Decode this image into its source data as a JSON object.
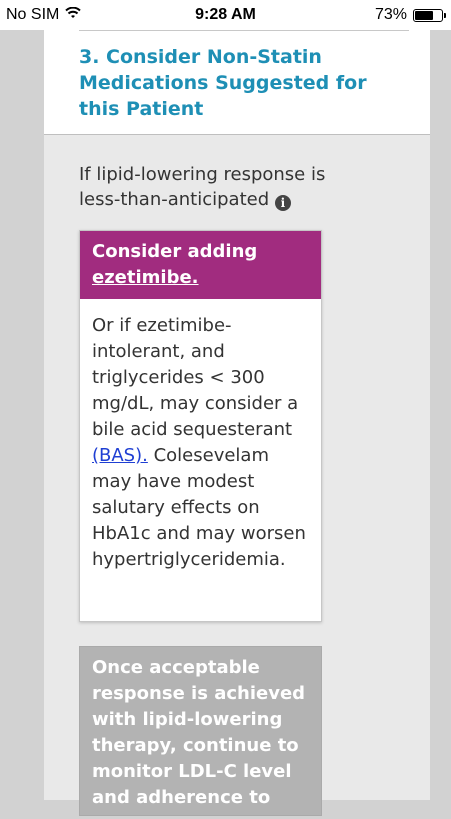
{
  "status_bar": {
    "carrier": "No SIM",
    "time": "9:28 AM",
    "battery_percent": "73%",
    "battery_level": 0.73,
    "wifi_icon": "wifi-icon",
    "battery_icon": "battery-icon"
  },
  "section": {
    "title": "3. Consider Non-Statin Medications Suggested for this Patient"
  },
  "intro": {
    "text": "If lipid-lowering response is less-than-anticipated",
    "info_icon": "info-icon"
  },
  "card": {
    "head_prefix": "Consider adding",
    "head_link": "ezetimibe.",
    "body_before": "Or if ezetimibe-intolerant, and triglycerides < 300 mg/dL, may consider a bile acid sequesterant",
    "body_link": "(BAS).",
    "body_after": "Colesevelam may have modest salutary effects on HbA1c and may worsen hypertriglyceridemia."
  },
  "next_card": {
    "text": "Once acceptable response is achieved with lipid-lowering therapy, continue to monitor LDL-C level and adherence to"
  },
  "colors": {
    "title_blue": "#1e8fb5",
    "card_header_magenta": "#a12c7f",
    "link_blue": "#1f3fd3",
    "gray_card": "#b3b3b3"
  }
}
